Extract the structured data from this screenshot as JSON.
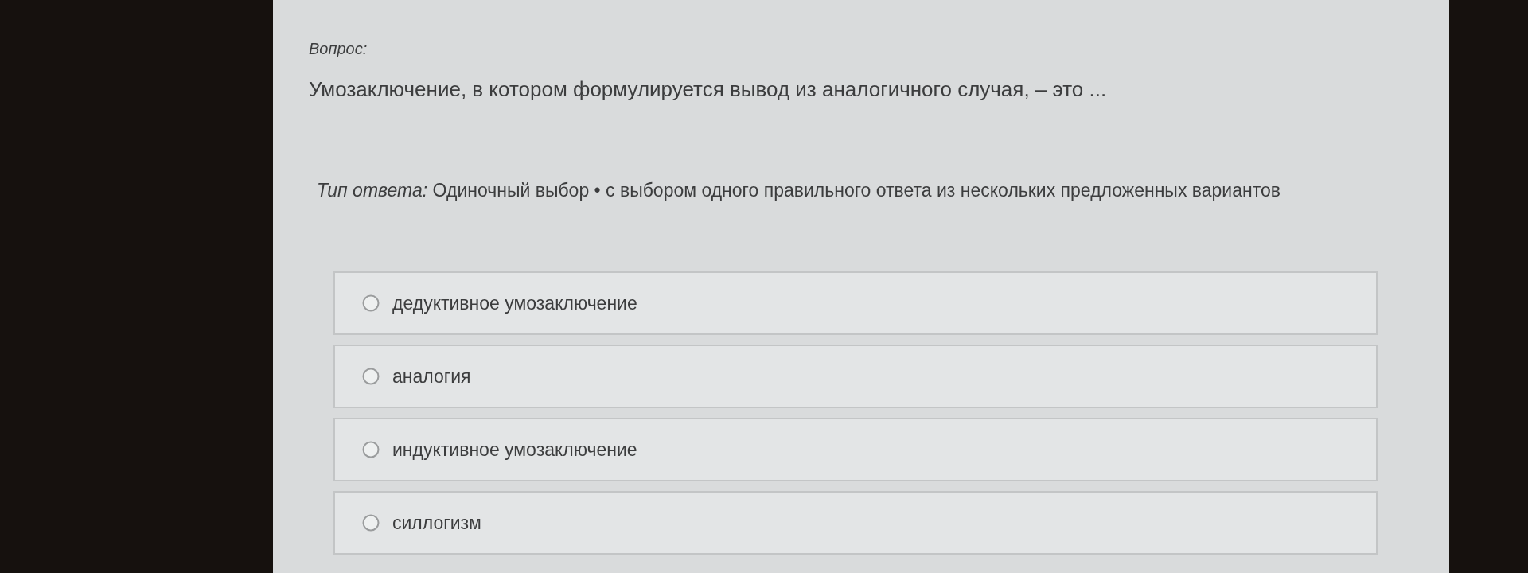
{
  "question": {
    "label": "Вопрос:",
    "text": "Умозаключение, в котором формулируется вывод из аналогичного случая, – это ..."
  },
  "answer_type": {
    "text": "*Тип ответа:* Одиночный выбор • с выбором одного правильного ответа из нескольких предложенных вариантов"
  },
  "options": [
    {
      "label": "дедуктивное умозаключение",
      "selected": false
    },
    {
      "label": "аналогия",
      "selected": false
    },
    {
      "label": "индуктивное умозаключение",
      "selected": false
    },
    {
      "label": "силлогизм",
      "selected": false
    }
  ]
}
